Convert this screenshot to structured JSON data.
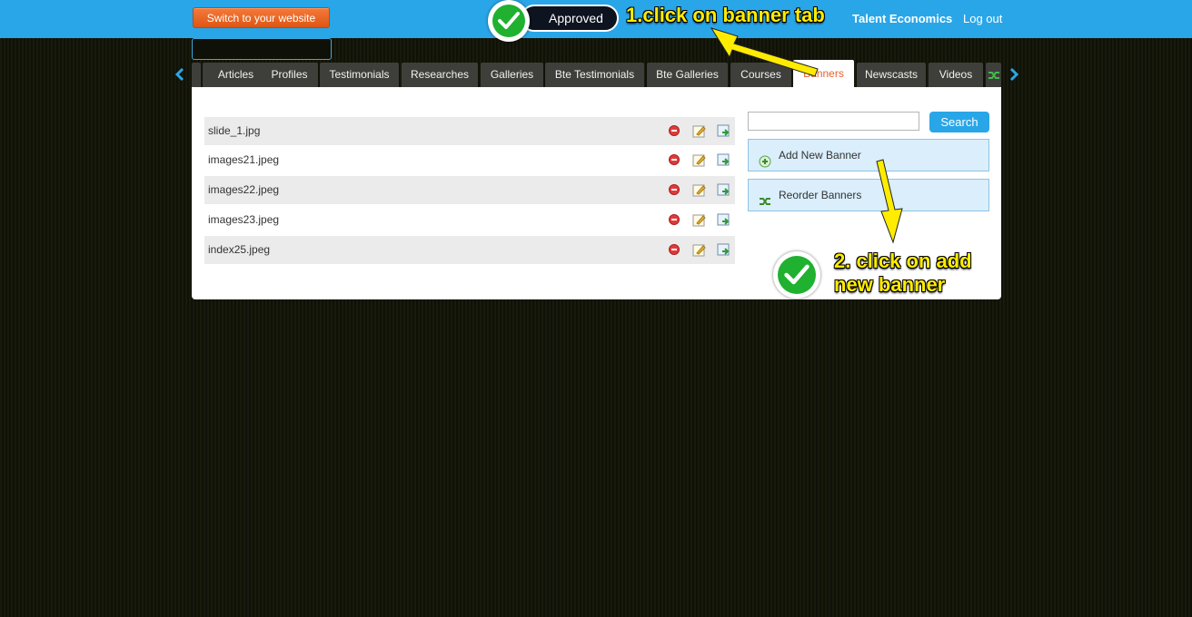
{
  "header": {
    "switch_label": "Switch to your website",
    "user_name": "Talent Economics",
    "logout_label": "Log out",
    "accent_color": "#29a6e8",
    "orange_color": "#e8612c"
  },
  "badge": {
    "approved_label": "Approved"
  },
  "annotations": {
    "step1": "1.click on banner tab",
    "step2_line1": "2. click on add",
    "step2_line2": "new banner",
    "arrow_color": "#ffec00"
  },
  "tabs": [
    {
      "label": ""
    },
    {
      "label": "Articles"
    },
    {
      "label": "Profiles"
    },
    {
      "label": "Testimonials"
    },
    {
      "label": "Researches"
    },
    {
      "label": "Galleries"
    },
    {
      "label": "Bte Testimonials"
    },
    {
      "label": "Bte Galleries"
    },
    {
      "label": "Courses"
    },
    {
      "label": "Banners",
      "active": true
    },
    {
      "label": "Newscasts"
    },
    {
      "label": "Videos"
    }
  ],
  "banners": [
    {
      "name": "slide_1.jpg"
    },
    {
      "name": "images21.jpeg"
    },
    {
      "name": "images22.jpeg"
    },
    {
      "name": "images23.jpeg"
    },
    {
      "name": "index25.jpeg"
    }
  ],
  "sidebar": {
    "search_placeholder": "",
    "search_label": "Search",
    "add_label": "Add New Banner",
    "reorder_label": "Reorder Banners"
  }
}
